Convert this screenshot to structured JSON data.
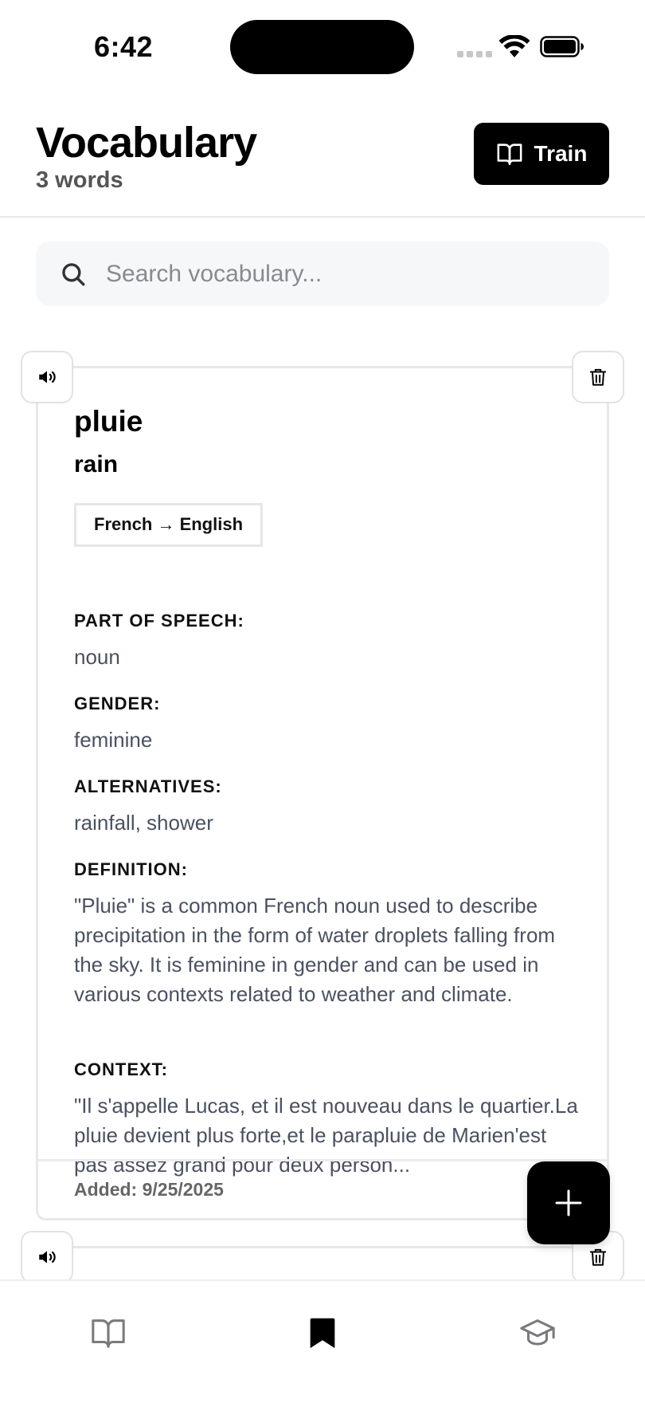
{
  "status_bar": {
    "time": "6:42"
  },
  "header": {
    "title": "Vocabulary",
    "word_count": "3 words",
    "train_label": "Train"
  },
  "search": {
    "placeholder": "Search vocabulary...",
    "value": ""
  },
  "cards": [
    {
      "term": "pluie",
      "translation": "rain",
      "language_pair": "French → English",
      "part_of_speech_label": "PART OF SPEECH:",
      "part_of_speech": "noun",
      "gender_label": "GENDER:",
      "gender": "feminine",
      "alternatives_label": "ALTERNATIVES:",
      "alternatives": "rainfall, shower",
      "definition_label": "DEFINITION:",
      "definition": "\"Pluie\" is a common French noun used to describe precipitation in the form of water droplets falling from the sky. It is feminine in gender and can be used in various contexts related to weather and climate.",
      "context_label": "CONTEXT:",
      "context": "\"Il s'appelle Lucas, et il est nouveau dans le quartier.La pluie devient plus forte,et le parapluie de Marien'est pas assez grand pour deux person...",
      "added": "Added: 9/25/2025"
    }
  ],
  "icons": {
    "speaker": "speaker-icon",
    "trash": "trash-icon",
    "search": "search-icon",
    "book": "book-open-icon",
    "plus": "plus-icon",
    "bookmark": "bookmark-icon",
    "graduation": "graduation-cap-icon"
  },
  "tabs": [
    {
      "name": "library",
      "active": false
    },
    {
      "name": "vocabulary",
      "active": true
    },
    {
      "name": "learn",
      "active": false
    }
  ]
}
